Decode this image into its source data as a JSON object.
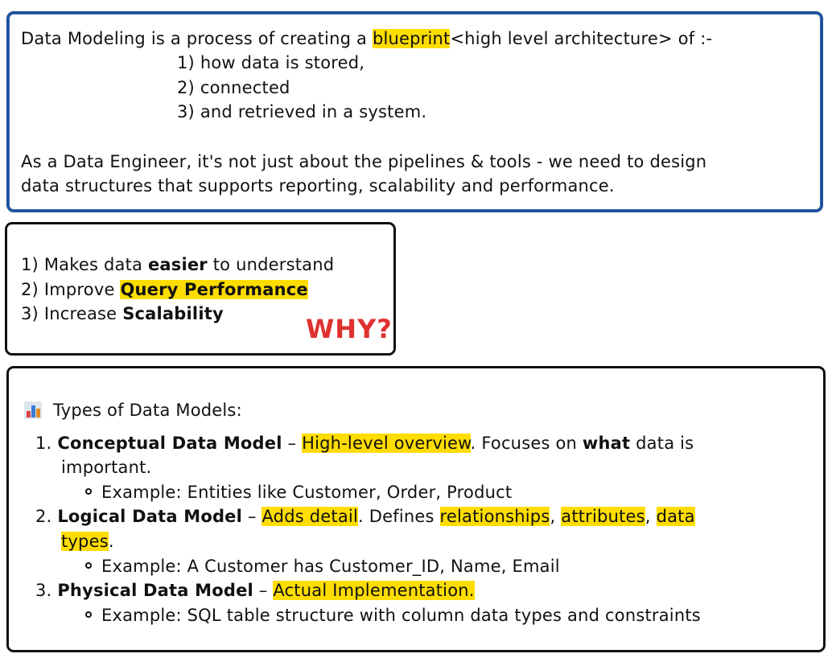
{
  "box1": {
    "line1_pre": "Data Modeling is a process of creating a ",
    "line1_hl": "blueprint",
    "line1_post": "<high level architecture> of :-",
    "items": [
      "1) how data is stored,",
      "2) connected",
      "3) and retrieved in a system."
    ],
    "para1": "As a Data Engineer, it's not just about the pipelines & tools - we need to design",
    "para2": "data structures that supports reporting, scalability and performance."
  },
  "box2": {
    "l1_pre": "1) Makes data ",
    "l1_bold": "easier",
    "l1_post": " to understand",
    "l2_pre": "2) Improve ",
    "l2_hl": "Query Performance",
    "l3_pre": "3) Increase ",
    "l3_bold": "Scalability",
    "why": "WHY?"
  },
  "box3": {
    "icon": "bar-chart-icon",
    "title": "Types of Data Models:",
    "m1_num": "1.",
    "m1_name": "Conceptual Data Model",
    "m1_dash": " – ",
    "m1_hl": "High-level overview",
    "m1_rest_a": ". Focuses on ",
    "m1_rest_b": "what",
    "m1_rest_c": " data is",
    "m1_cont": "important.",
    "m1_ex": "Example: Entities like Customer, Order, Product",
    "m2_num": "2.",
    "m2_name": "Logical Data Model",
    "m2_dash": " – ",
    "m2_hl": "Adds detail",
    "m2_rest": ". Defines ",
    "m2_hl2": "relationships",
    "m2_comma": ", ",
    "m2_hl3": "attributes",
    "m2_comma2": ", ",
    "m2_hl4a": "data",
    "m2_hl4b": "types",
    "m2_period": ".",
    "m2_ex": "Example: A Customer has Customer_ID, Name, Email",
    "m3_num": "3.",
    "m3_name": "Physical Data Model",
    "m3_dash": " – ",
    "m3_hl": "Actual Implementation.",
    "m3_ex": "Example: SQL table structure with column data types and constraints"
  },
  "colors": {
    "highlight": "#ffdd00",
    "why": "#e03131",
    "box1_border": "#1b4f9c"
  }
}
